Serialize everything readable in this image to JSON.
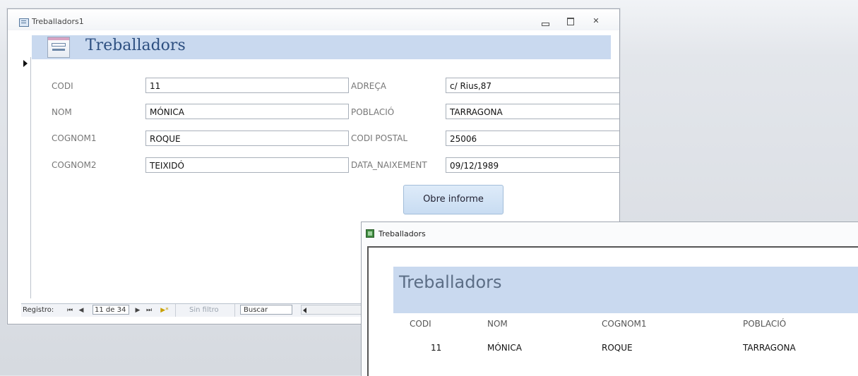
{
  "form_window": {
    "title": "Treballadors1",
    "header_title": "Treballadors",
    "close_glyph": "✕",
    "fields": {
      "codi": {
        "label": "CODI",
        "value": "11"
      },
      "nom": {
        "label": "NOM",
        "value": "MÓNICA"
      },
      "cognom1": {
        "label": "COGNOM1",
        "value": "ROQUE"
      },
      "cognom2": {
        "label": "COGNOM2",
        "value": "TEIXIDÓ"
      },
      "adreca": {
        "label": "ADREÇA",
        "value": "c/ Rius,87"
      },
      "poblacio": {
        "label": "POBLACIÓ",
        "value": "TARRAGONA"
      },
      "codi_postal": {
        "label": "CODI POSTAL",
        "value": "25006"
      },
      "data_naixement": {
        "label": "DATA_NAIXEMENT",
        "value": "09/12/1989"
      }
    },
    "open_report_button": "Obre informe",
    "navigation": {
      "label": "Registro:",
      "first": "⏮",
      "prev": "◀",
      "record_position": "11 de 34",
      "next": "▶",
      "last": "⏭",
      "new": "▶*",
      "filter": "Sin filtro",
      "search": "Buscar"
    }
  },
  "report_window": {
    "title": "Treballadors",
    "header_title": "Treballadors",
    "columns": [
      "CODI",
      "NOM",
      "COGNOM1",
      "POBLACIÓ"
    ],
    "rows": [
      [
        "11",
        "MÓNICA",
        "ROQUE",
        "TARRAGONA"
      ]
    ]
  }
}
